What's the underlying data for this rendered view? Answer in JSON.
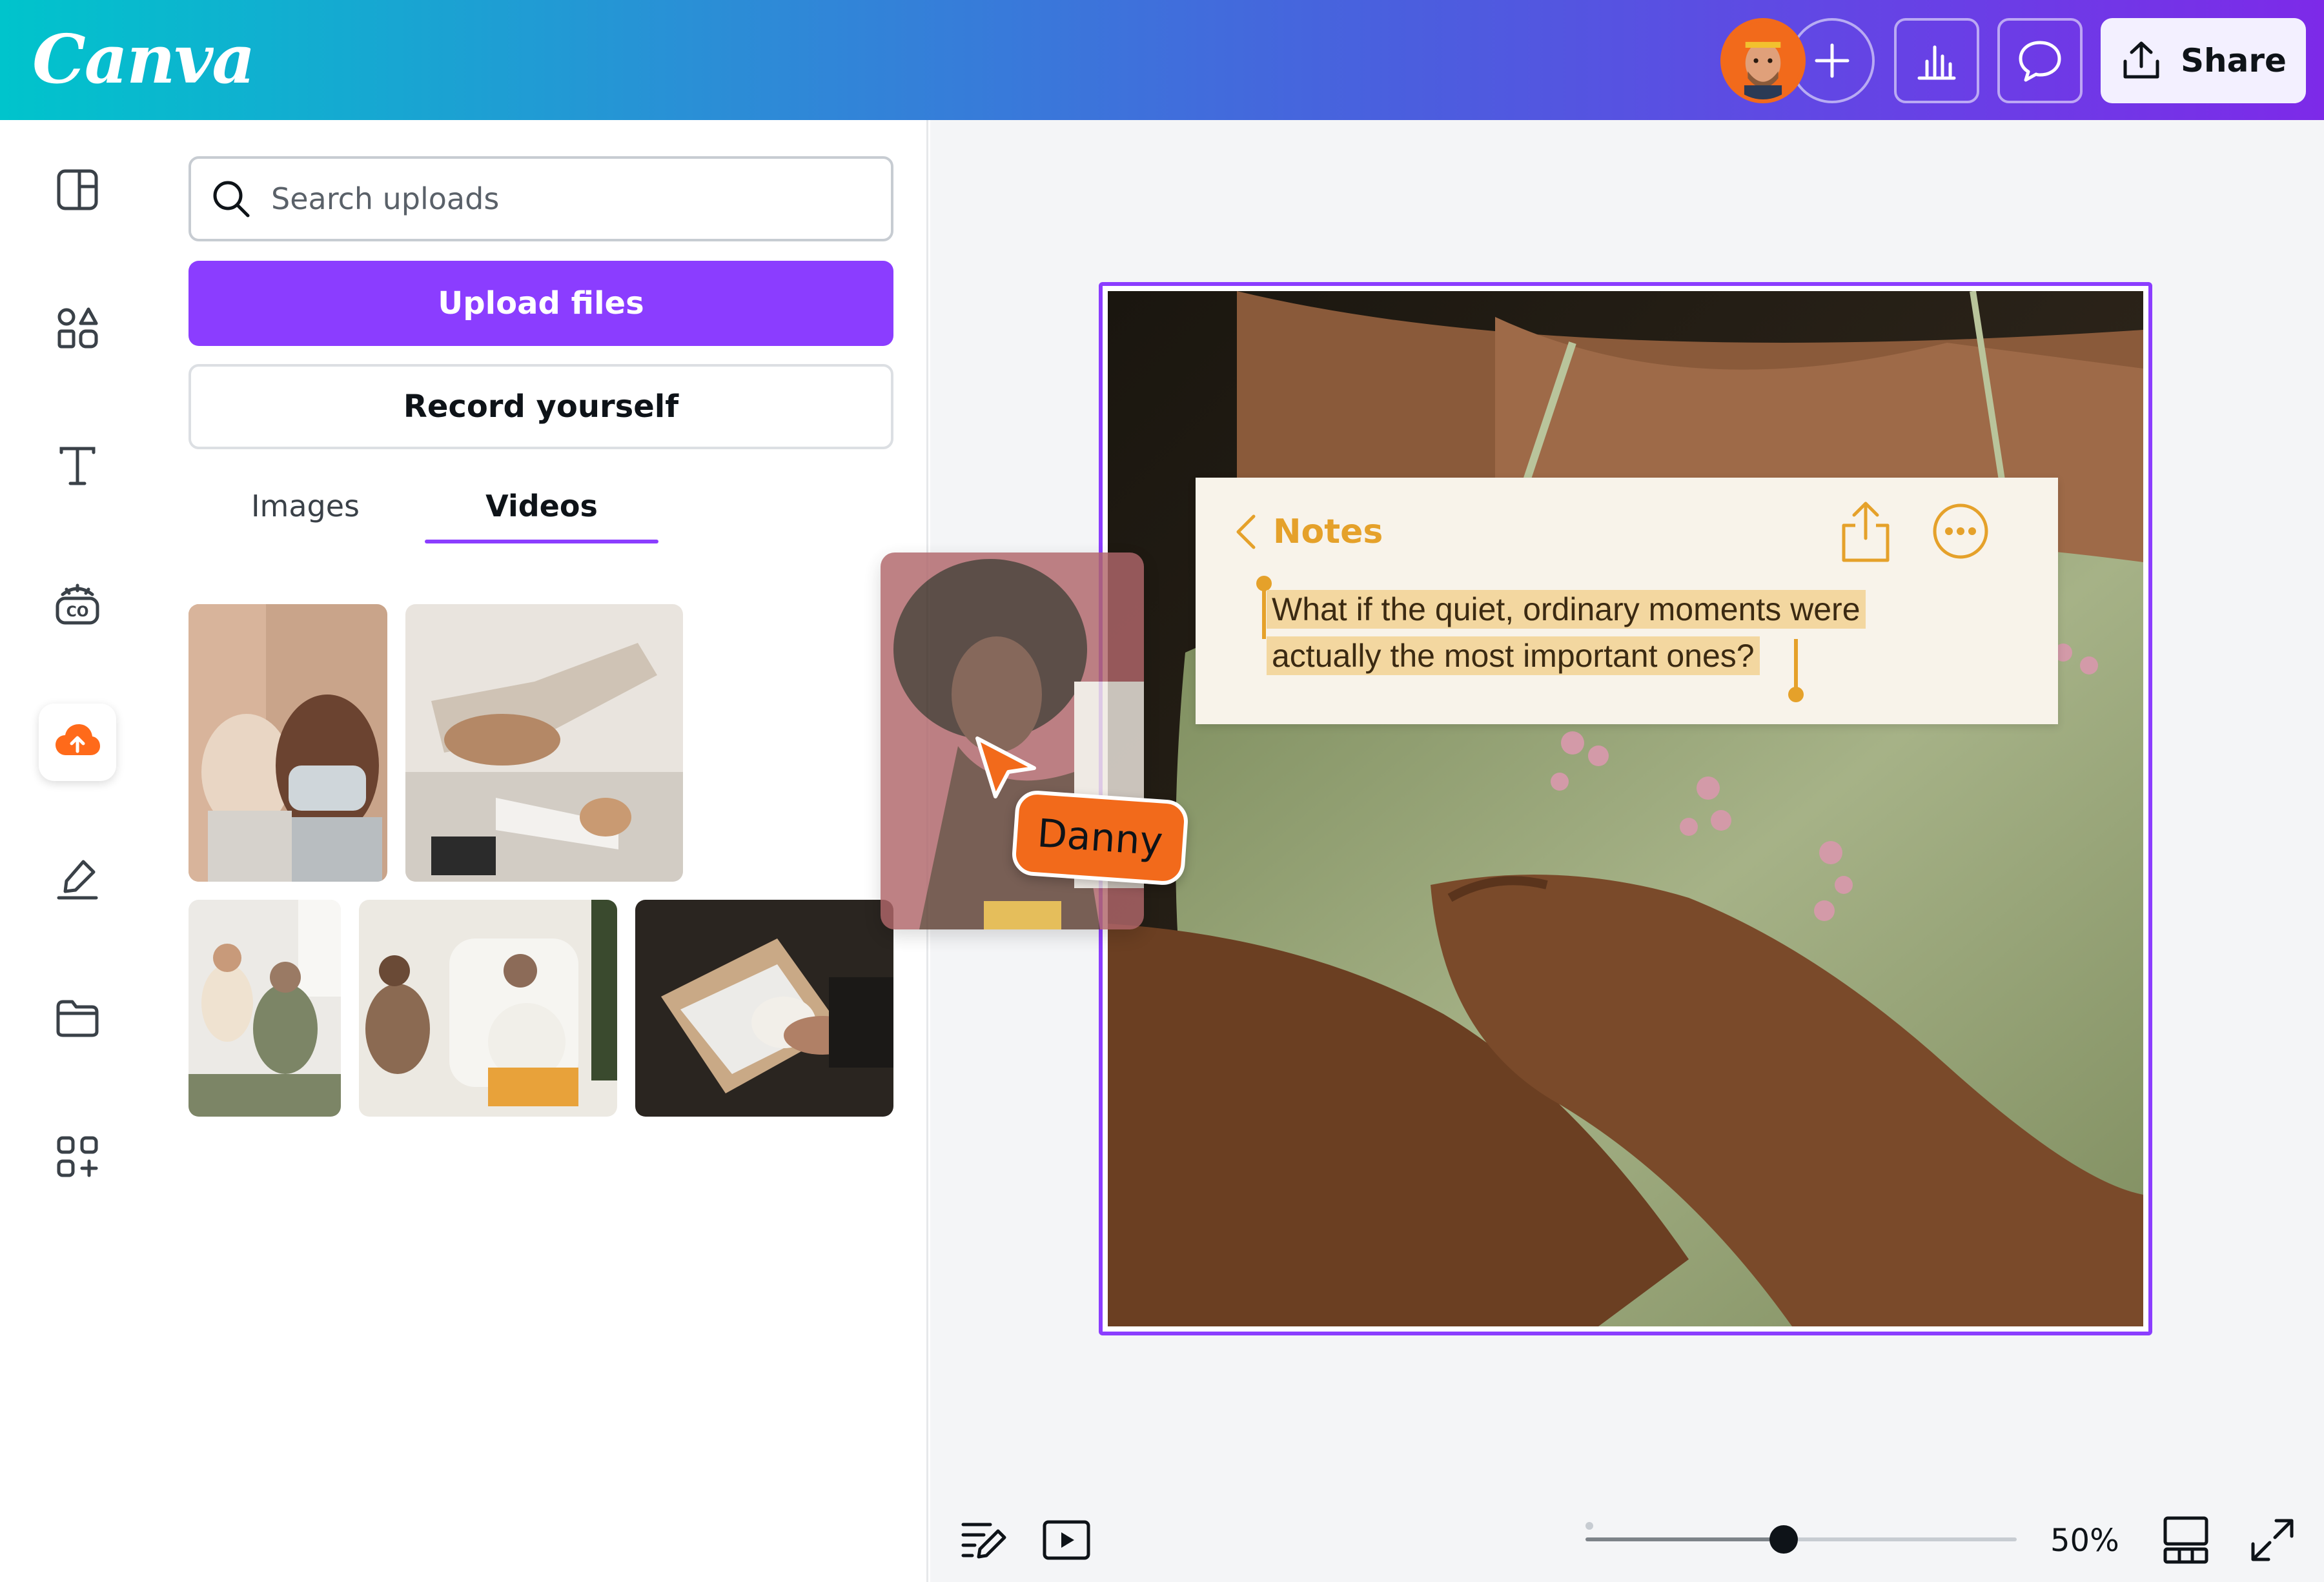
{
  "app": {
    "logo_text": "Canva",
    "accent_color": "#8b3dff",
    "cursor_color": "#f26a1b"
  },
  "header": {
    "share_label": "Share",
    "icons": [
      "user-avatar",
      "plus-icon",
      "bar-chart-icon",
      "comment-icon",
      "share-upload-icon"
    ]
  },
  "rail": {
    "items": [
      {
        "icon": "templates-icon"
      },
      {
        "icon": "elements-icon"
      },
      {
        "icon": "text-icon"
      },
      {
        "icon": "brand-icon"
      },
      {
        "icon": "uploads-icon",
        "active": true
      },
      {
        "icon": "draw-icon"
      },
      {
        "icon": "projects-folder-icon"
      },
      {
        "icon": "apps-icon"
      }
    ]
  },
  "uploads": {
    "search_placeholder": "Search uploads",
    "upload_label": "Upload files",
    "record_label": "Record yourself",
    "tabs": [
      {
        "label": "Images",
        "active": false
      },
      {
        "label": "Videos",
        "active": true
      }
    ]
  },
  "collaborator": {
    "name": "Danny"
  },
  "notes": {
    "title": "Notes",
    "line1": "What if the quiet, ordinary moments were",
    "line2": "actually the most important ones?",
    "color": "#e5a12a",
    "highlight_color": "#f3d7a0"
  },
  "footer": {
    "zoom_label": "50%",
    "zoom_level": 0.5
  }
}
